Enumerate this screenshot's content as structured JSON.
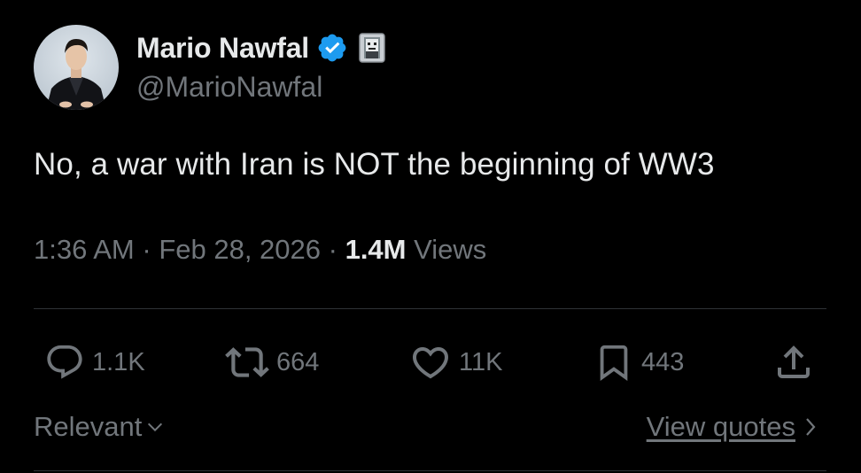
{
  "author": {
    "display_name": "Mario Nawfal",
    "handle": "@MarioNawfal",
    "verified": true,
    "verified_icon": "verified-badge-icon",
    "affiliate_icon": "affiliate-badge-icon"
  },
  "tweet": {
    "text": "No, a war with Iran is NOT the beginning of WW3"
  },
  "meta": {
    "time": "1:36 AM",
    "separator": "·",
    "date": "Feb 28, 2026",
    "views_count": "1.4M",
    "views_label": "Views"
  },
  "actions": {
    "reply": {
      "icon": "reply-icon",
      "count": "1.1K"
    },
    "repost": {
      "icon": "repost-icon",
      "count": "664"
    },
    "like": {
      "icon": "heart-icon",
      "count": "11K"
    },
    "bookmark": {
      "icon": "bookmark-icon",
      "count": "443"
    },
    "share": {
      "icon": "share-icon"
    }
  },
  "footer": {
    "sort_label": "Relevant",
    "view_quotes_label": "View quotes"
  },
  "colors": {
    "background": "#000000",
    "primary_text": "#e7e9ea",
    "secondary_text": "#71767b",
    "divider": "#2f3336",
    "verified_blue": "#1d9bf0"
  }
}
